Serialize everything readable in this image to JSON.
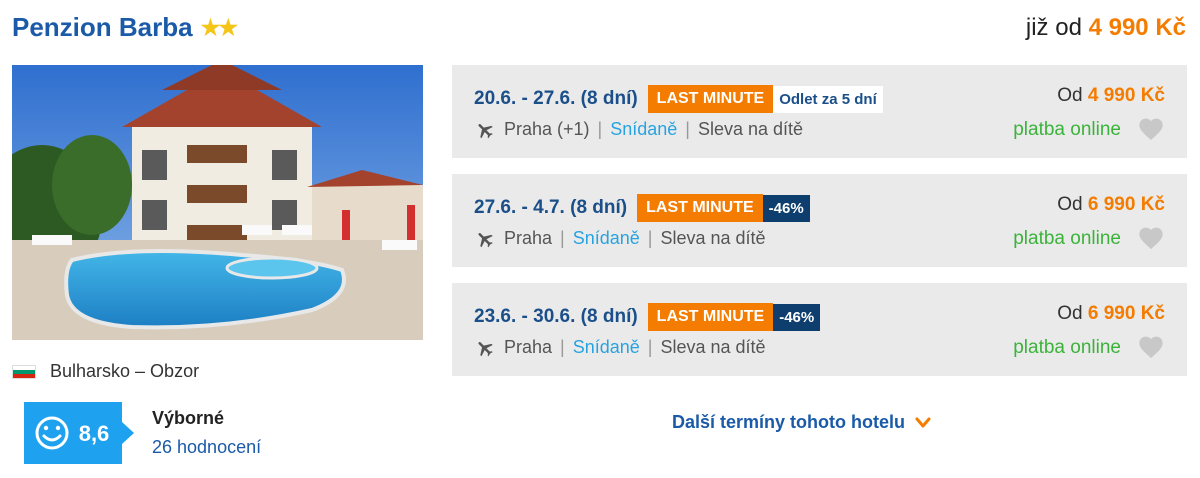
{
  "hotel": {
    "name": "Penzion Barba",
    "stars": "★★",
    "price_prefix": "již od",
    "price": "4 990 Kč",
    "location": "Bulharsko – Obzor",
    "rating": {
      "score": "8,6",
      "label": "Výborné",
      "count": "26 hodnocení"
    }
  },
  "offers": [
    {
      "dates": "20.6. - 27.6. (8 dní)",
      "badge": "LAST MINUTE",
      "badge2": "Odlet za 5 dní",
      "origin": "Praha (+1)",
      "board": "Snídaně",
      "extra": "Sleva na dítě",
      "price_prefix": "Od",
      "price": "4 990 Kč",
      "payment": "platba online"
    },
    {
      "dates": "27.6. - 4.7. (8 dní)",
      "badge": "LAST MINUTE",
      "badge2": "-46%",
      "origin": "Praha",
      "board": "Snídaně",
      "extra": "Sleva na dítě",
      "price_prefix": "Od",
      "price": "6 990 Kč",
      "payment": "platba online"
    },
    {
      "dates": "23.6. - 30.6. (8 dní)",
      "badge": "LAST MINUTE",
      "badge2": "-46%",
      "origin": "Praha",
      "board": "Snídaně",
      "extra": "Sleva na dítě",
      "price_prefix": "Od",
      "price": "6 990 Kč",
      "payment": "platba online"
    }
  ],
  "more_dates": "Další termíny tohoto hotelu",
  "icons": {
    "flag": "bulgaria-flag-icon",
    "smiley": "smiley-icon",
    "plane": "plane-icon",
    "heart": "heart-icon",
    "chevron": "chevron-down-icon"
  },
  "colors": {
    "brand_blue": "#1a5aa8",
    "orange": "#f47c00",
    "rating_blue": "#1ea1ef",
    "green": "#3bb33b",
    "dark_badge": "#0d3e6e"
  }
}
